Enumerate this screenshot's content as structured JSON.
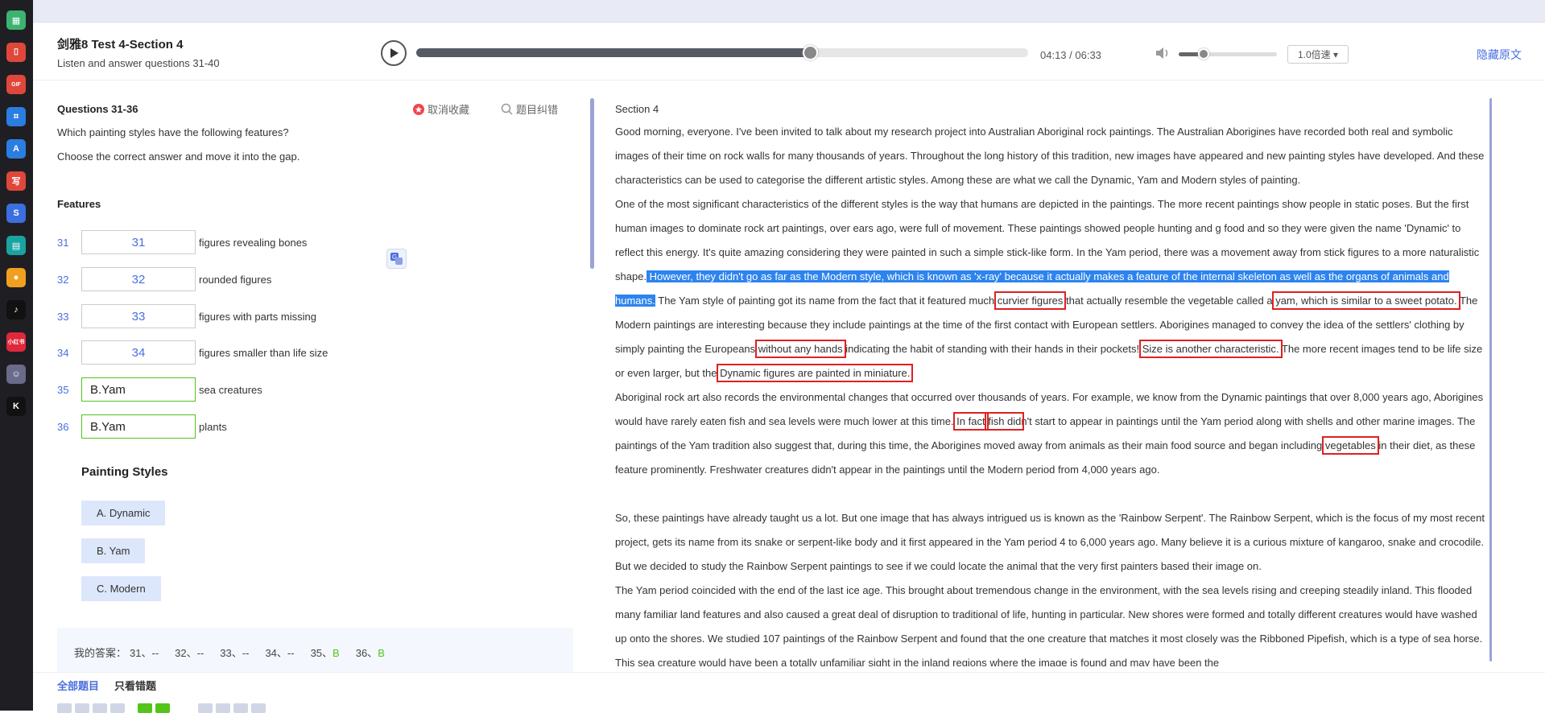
{
  "header": {
    "title": "剑雅8 Test 4-Section 4",
    "subtitle": "Listen and answer questions 31-40",
    "time": "04:13 / 06:33",
    "progress": 0.645,
    "volume": 0.25,
    "speed": "1.0倍速",
    "hide_text": "隐藏原文"
  },
  "dock": [
    {
      "name": "qr-icon",
      "color": "#3cb371",
      "glyph": "▦"
    },
    {
      "name": "pdf-icon",
      "color": "#e0473b",
      "glyph": "⌷"
    },
    {
      "name": "gif-icon",
      "color": "#e0473b",
      "glyph": "GIF"
    },
    {
      "name": "crop-icon",
      "color": "#2a7de1",
      "glyph": "⌗"
    },
    {
      "name": "scan-icon",
      "color": "#2a7de1",
      "glyph": "A"
    },
    {
      "name": "write-icon",
      "color": "#e0473b",
      "glyph": "写"
    },
    {
      "name": "ds-icon",
      "color": "#3b6fe0",
      "glyph": "S"
    },
    {
      "name": "table-icon",
      "color": "#1aa3a3",
      "glyph": "▤"
    },
    {
      "name": "pin-icon",
      "color": "#f0a020",
      "glyph": "●"
    },
    {
      "name": "tiktok-icon",
      "color": "#111111",
      "glyph": "♪"
    },
    {
      "name": "redbook-icon",
      "color": "#e0283b",
      "glyph": "小红书"
    },
    {
      "name": "avatar-icon",
      "color": "#6a6a8a",
      "glyph": "☺"
    },
    {
      "name": "k-icon",
      "color": "#111111",
      "glyph": "K"
    }
  ],
  "left": {
    "q_title": "Questions 31-36",
    "fav": "取消收藏",
    "report": "题目纠错",
    "instr1": "Which painting styles have the following features?",
    "instr2": "Choose the correct answer and move it into the gap.",
    "features_title": "Features",
    "rows": [
      {
        "num": "31",
        "gap": "31",
        "label": "figures revealing bones",
        "filled": false
      },
      {
        "num": "32",
        "gap": "32",
        "label": "rounded figures",
        "filled": false
      },
      {
        "num": "33",
        "gap": "33",
        "label": "figures with parts missing",
        "filled": false
      },
      {
        "num": "34",
        "gap": "34",
        "label": "figures smaller than life size",
        "filled": false
      },
      {
        "num": "35",
        "gap": "B.Yam",
        "label": "sea creatures",
        "filled": true
      },
      {
        "num": "36",
        "gap": "B.Yam",
        "label": "plants",
        "filled": true
      }
    ],
    "styles_title": "Painting Styles",
    "styles": [
      "A. Dynamic",
      "B. Yam",
      "C. Modern"
    ],
    "answer_label": "我的答案：",
    "answers": [
      {
        "q": "31、",
        "v": "--",
        "green": false
      },
      {
        "q": "32、",
        "v": "--",
        "green": false
      },
      {
        "q": "33、",
        "v": "--",
        "green": false
      },
      {
        "q": "34、",
        "v": "--",
        "green": false
      },
      {
        "q": "35、",
        "v": "B",
        "green": true
      },
      {
        "q": "36、",
        "v": "B",
        "green": true
      }
    ]
  },
  "right": {
    "section": "Section 4",
    "p1": "Good morning, everyone. I've been invited to talk about my research project into Australian Aboriginal rock paintings. The Australian Aborigines have recorded both real and symbolic images of their time on rock walls for many thousands of years. Throughout the long history of this tradition, new images have appeared and new painting styles have developed. And these characteristics can be used to categorise the different artistic styles. Among these are what we call the Dynamic, Yam and Modern styles of painting.",
    "p2a": "One of the most significant characteristics of the different styles is the way that humans are depicted in the paintings. The more recent paintings show people in static poses. But the first human images to dominate rock art paintings, over ears ago, were full of movement. These paintings showed people hunting and g food and so they were given the name 'Dynamic' to reflect this energy. It's quite amazing considering they were painted in such a simple stick-like form. In the Yam period, there was a movement away from stick figures to a more naturalistic shape.",
    "p2_hl": " However, they didn't go as far as the Modern style, which is known as 'x-ray' because it actually makes a feature of the internal skeleton as well as the organs of animals and humans.",
    "p2b": " The Yam style of painting got its name from the fact that it featured much ",
    "p2_box1": "curvier figures",
    "p2c": " that actually resemble the vegetable called a ",
    "p2_box2": "yam, which is similar to a sweet potato.",
    "p2d": " The Modern paintings are interesting because they include paintings at the time of the first contact with European settlers. Aborigines managed to convey the idea of the settlers' clothing by simply painting the Europeans ",
    "p2_box3": "without any hands",
    "p2e": " indicating the habit of standing with their hands in their pockets! ",
    "p2_box4": "Size is another characteristic.",
    "p2f": " The more recent images tend to be life size or even larger, but the ",
    "p2_box5": "Dynamic figures are painted in miniature.",
    "p3a": "Aboriginal rock art also records the environmental changes that occurred over thousands of years. For example, we know from the Dynamic paintings that over 8,000 years ago, Aborigines would have rarely eaten fish and sea levels were much lower at this time. ",
    "p3_box1": "In fact",
    "p3_box2": "fish did",
    "p3b": "n't start to appear in paintings until the Yam period along with shells and other marine images. The paintings of the Yam tradition also suggest that, during this time, the Aborigines moved away from animals as their main food source and began including ",
    "p3_box3": "vegetables",
    "p3c": " in their diet, as these feature prominently. Freshwater creatures didn't appear in the paintings until the Modern period from 4,000 years ago.",
    "p4": "So, these paintings have already taught us a lot. But one image that has always intrigued us is known as the 'Rainbow Serpent'. The Rainbow Serpent, which is the focus of my most recent project, gets its name from its snake or serpent-like body and it first appeared in the Yam period 4 to 6,000 years ago. Many believe it is a curious mixture of kangaroo, snake and crocodile. But we decided to study the Rainbow Serpent paintings to see if we could locate the animal that the very first painters based their image on.",
    "p5": "The Yam period coincided with the end of the last ice age. This brought about tremendous change in the environment, with the sea levels rising and creeping steadily inland. This flooded many familiar land features and also caused a great deal of disruption to traditional of life, hunting in particular. New shores were formed and totally different creatures would have washed up onto the shores. We studied 107 paintings of the Rainbow Serpent and found that the one creature that matches it most closely was the Ribboned Pipefish, which is a type of sea horse. This sea creature would have been a totally unfamiliar sight in the inland regions where the image is found and may have been the"
  },
  "bottom": {
    "tab_all": "全部题目",
    "tab_wrong": "只看错题"
  }
}
